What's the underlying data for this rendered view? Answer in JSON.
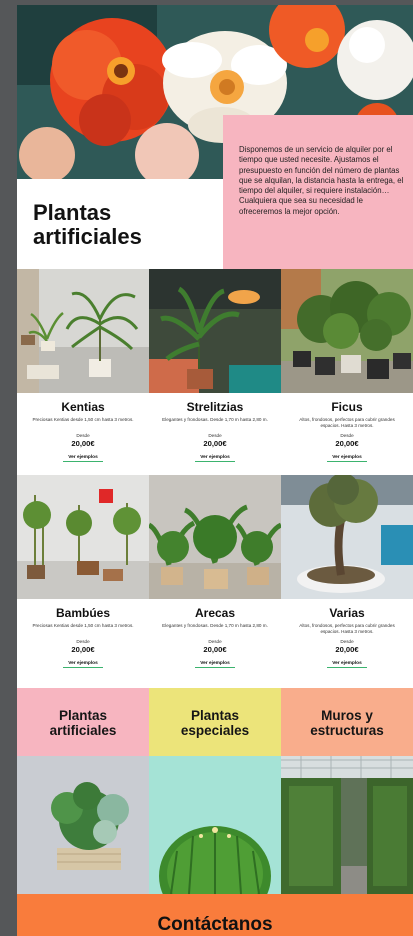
{
  "hero": {
    "title_line1": "Plantas",
    "title_line2": "artificiales",
    "description": "Disponemos de un servicio de alquiler por el tiempo que usted necesite. Ajustamos el presupuesto en función del número de plantas que se alquilan, la distancia hasta la entrega, el tiempo del alquiler, si requiere instalación… Cualquiera que sea su necesidad le ofreceremos la mejor opción.",
    "colors": {
      "pink": "#f7b5c0"
    }
  },
  "products": [
    {
      "name": "Kentias",
      "desc": "Preciosas Kentias desde 1,50 cm hasta 3 metros.",
      "from": "Desde",
      "price": "20,00€",
      "link": "Ver ejemplos"
    },
    {
      "name": "Strelitzias",
      "desc": "Elegantes y frondosas. Desde 1,70 m hasta 2,80 m.",
      "from": "Desde",
      "price": "20,00€",
      "link": "Ver ejemplos"
    },
    {
      "name": "Ficus",
      "desc": "Altos, frondosos, perfectos para cubrir grandes espacios. Hasta 3 metros.",
      "from": "Desde",
      "price": "20,00€",
      "link": "Ver ejemplos"
    },
    {
      "name": "Bambúes",
      "desc": "Preciosas Kentias desde 1,50 cm hasta 3 metros.",
      "from": "Desde",
      "price": "20,00€",
      "link": "Ver ejemplos"
    },
    {
      "name": "Arecas",
      "desc": "Elegantes y frondosas. Desde 1,70 m hasta 2,80 m.",
      "from": "Desde",
      "price": "20,00€",
      "link": "Ver ejemplos"
    },
    {
      "name": "Varias",
      "desc": "Altos, frondosos, perfectos para cubrir grandes espacios. Hasta 3 metros.",
      "from": "Desde",
      "price": "20,00€",
      "link": "Ver ejemplos"
    }
  ],
  "categories": [
    {
      "line1": "Plantas",
      "line2": "artificiales",
      "color": "#f7b5c0"
    },
    {
      "line1": "Plantas",
      "line2": "especiales",
      "color": "#ece47a"
    },
    {
      "line1": "Muros y",
      "line2": "estructuras",
      "color": "#f9ad8c"
    }
  ],
  "contact": {
    "title": "Contáctanos",
    "color": "#f97c3c"
  },
  "accent": {
    "link_underline": "#3bb36e"
  }
}
